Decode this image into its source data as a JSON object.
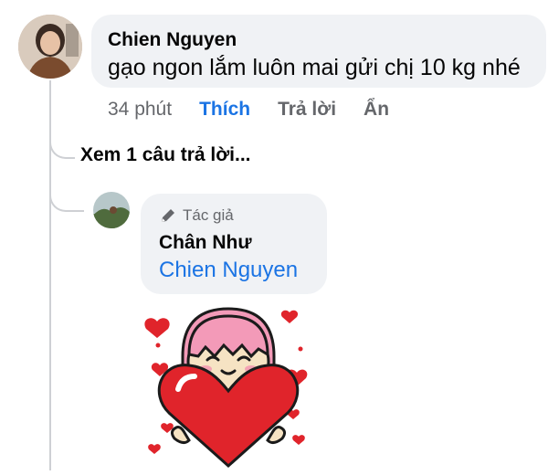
{
  "comment": {
    "author": "Chien Nguyen",
    "text": "gạo ngon lắm luôn mai gửi chị 10 kg nhé",
    "time": "34 phút",
    "like_label": "Thích",
    "reply_label": "Trả lời",
    "hide_label": "Ẩn"
  },
  "view_replies": "Xem 1 câu trả lời...",
  "reply": {
    "badge_label": "Tác giả",
    "author": "Chân Như",
    "mention": "Chien Nguyen",
    "sticker": "girl-holding-heart-sticker"
  },
  "colors": {
    "accent": "#1b74e4",
    "bubble": "#f0f2f5",
    "heart": "#e0242b",
    "hair": "#f39ab8"
  }
}
